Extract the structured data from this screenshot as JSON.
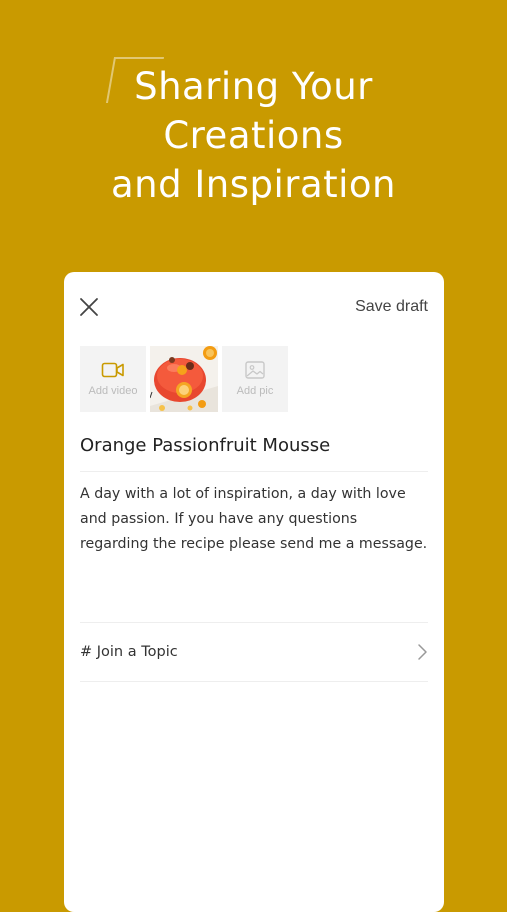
{
  "hero": {
    "title_lines": [
      "Sharing Your",
      "Creations",
      "and Inspiration"
    ]
  },
  "editor": {
    "save_draft_label": "Save draft",
    "add_video_label": "Add video",
    "add_pic_label": "Add pic",
    "title_value": "Orange Passionfruit Mousse",
    "body_value": "A day with a lot of inspiration, a day with love and passion. If you have any questions regarding the recipe please send me a message.",
    "topic_label": "# Join a Topic"
  },
  "colors": {
    "background": "#c99a00",
    "card": "#ffffff",
    "accent_icon": "#c99a00"
  },
  "icons": [
    "close-icon",
    "video-camera-icon",
    "image-icon",
    "chevron-right-icon"
  ]
}
